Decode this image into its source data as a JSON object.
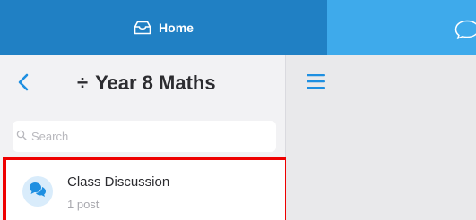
{
  "tabs": {
    "home_label": "Home"
  },
  "header": {
    "divide_symbol": "÷",
    "title": "Year 8 Maths"
  },
  "search": {
    "placeholder": "Search"
  },
  "list": {
    "items": [
      {
        "title": "Class Discussion",
        "subtitle": "1 post"
      }
    ]
  },
  "colors": {
    "home_tab": "#2080c4",
    "right_tab": "#3eaaeb",
    "accent": "#1e8fe1",
    "highlight_border": "#ee0000"
  },
  "icons": {
    "home_tab_icon": "inbox-icon",
    "right_tab_icon": "chat-bubble-icon",
    "back": "chevron-left-icon",
    "search": "search-icon",
    "menu": "hamburger-menu-icon",
    "item_avatar": "discussion-icon"
  }
}
